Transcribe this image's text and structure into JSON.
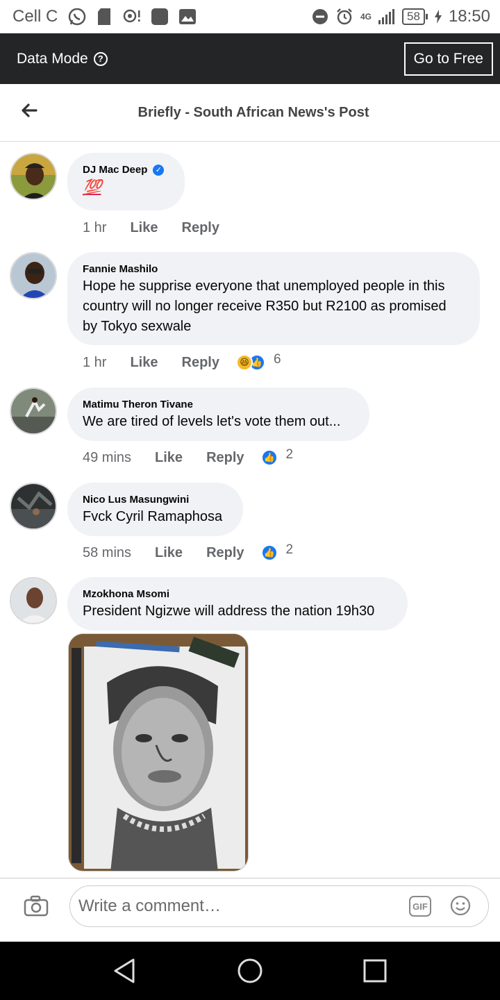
{
  "status_bar": {
    "carrier": "Cell C",
    "network": "4G",
    "battery": "58",
    "time": "18:50"
  },
  "data_bar": {
    "label": "Data Mode",
    "go_free": "Go to Free"
  },
  "header": {
    "title": "Briefly - South African News's Post"
  },
  "comments": [
    {
      "author": "DJ Mac Deep",
      "verified": true,
      "text": "💯",
      "time": "1 hr",
      "like": "Like",
      "reply": "Reply",
      "reactions": []
    },
    {
      "author": "Fannie Mashilo",
      "text": "Hope he supprise everyone that unemployed people in this country will no longer receive R350 but R2100 as promised by Tokyo sexwale",
      "time": "1 hr",
      "like": "Like",
      "reply": "Reply",
      "reactions": [
        "haha",
        "like"
      ],
      "reaction_count": "6"
    },
    {
      "author": "Matimu Theron Tivane",
      "text": "We are tired of levels let's vote them out...",
      "time": "49 mins",
      "like": "Like",
      "reply": "Reply",
      "reactions": [
        "like"
      ],
      "reaction_count": "2"
    },
    {
      "author": "Nico Lus Masungwini",
      "text": "Fvck Cyril Ramaphosa",
      "time": "58 mins",
      "like": "Like",
      "reply": "Reply",
      "reactions": [
        "like"
      ],
      "reaction_count": "2"
    },
    {
      "author": "Mzokhona Msomi",
      "text": "President Ngizwe will address the nation 19h30"
    }
  ],
  "composer": {
    "placeholder": "Write a comment…",
    "gif_label": "GIF"
  },
  "colors": {
    "dark_bar": "#242526",
    "bubble": "#f0f2f5",
    "like_blue": "#1877f2",
    "meta_gray": "#65676b"
  }
}
